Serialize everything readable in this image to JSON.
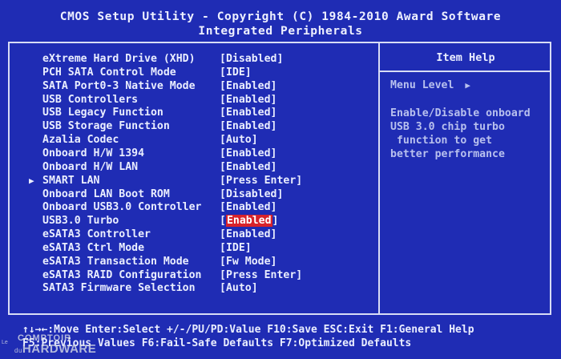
{
  "header": {
    "line1": "CMOS Setup Utility - Copyright (C) 1984-2010 Award Software",
    "line2": "Integrated Peripherals"
  },
  "settings": [
    {
      "label": "eXtreme Hard Drive (XHD)",
      "value": "[Disabled]",
      "submenu": false
    },
    {
      "label": "PCH SATA Control Mode",
      "value": "[IDE]",
      "submenu": false
    },
    {
      "label": "SATA Port0-3 Native Mode",
      "value": "[Enabled]",
      "submenu": false
    },
    {
      "label": "USB Controllers",
      "value": "[Enabled]",
      "submenu": false
    },
    {
      "label": "USB Legacy Function",
      "value": "[Enabled]",
      "submenu": false
    },
    {
      "label": "USB Storage Function",
      "value": "[Enabled]",
      "submenu": false
    },
    {
      "label": "Azalia Codec",
      "value": "[Auto]",
      "submenu": false
    },
    {
      "label": "Onboard H/W 1394",
      "value": "[Enabled]",
      "submenu": false
    },
    {
      "label": "Onboard H/W LAN",
      "value": "[Enabled]",
      "submenu": false
    },
    {
      "label": "SMART LAN",
      "value": "[Press Enter]",
      "submenu": true
    },
    {
      "label": "Onboard LAN Boot ROM",
      "value": "[Disabled]",
      "submenu": false
    },
    {
      "label": "Onboard USB3.0 Controller",
      "value": "[Enabled]",
      "submenu": false
    },
    {
      "label": "USB3.0 Turbo",
      "value": "Enabled",
      "value_prefix": "[",
      "value_suffix": "]",
      "submenu": false,
      "selected": true
    },
    {
      "label": "eSATA3 Controller",
      "value": "[Enabled]",
      "submenu": false
    },
    {
      "label": "eSATA3 Ctrl Mode",
      "value": "[IDE]",
      "submenu": false
    },
    {
      "label": "eSATA3 Transaction Mode",
      "value": "[Fw Mode]",
      "submenu": false
    },
    {
      "label": "eSATA3 RAID Configuration",
      "value": "[Press Enter]",
      "submenu": false
    },
    {
      "label": "SATA3 Firmware Selection",
      "value": "[Auto]",
      "submenu": false
    }
  ],
  "help": {
    "title": "Item Help",
    "menu_level_label": "Menu Level",
    "menu_level_arrow": "▶",
    "lines": [
      "Enable/Disable onboard",
      "USB 3.0 chip turbo",
      " function to get",
      "better performance"
    ]
  },
  "footer": {
    "line1": "↑↓→←:Move  Enter:Select  +/-/PU/PD:Value  F10:Save  ESC:Exit  F1:General Help",
    "line2": "F5:Previous Values  F6:Fail-Safe Defaults  F7:Optimized Defaults"
  },
  "watermark": {
    "small": "Le",
    "top": "COMPTOIR",
    "prefix": "du",
    "big": "HARDWARE"
  },
  "colors": {
    "background": "#1f2cb4",
    "text": "#eaeeff",
    "highlight": "#d8222b",
    "border": "#d8dcf5"
  }
}
